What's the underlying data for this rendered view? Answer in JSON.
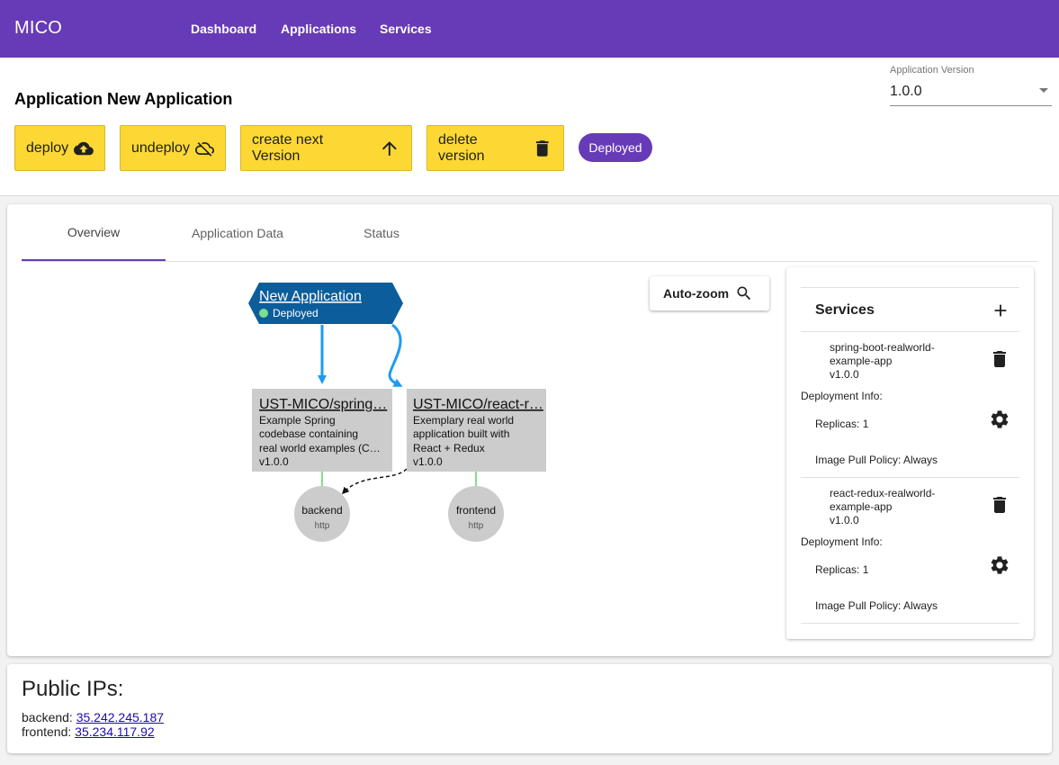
{
  "topbar": {
    "brand": "MICO",
    "nav": [
      "Dashboard",
      "Applications",
      "Services"
    ]
  },
  "app": {
    "title": "Application New Application",
    "version_label": "Application Version",
    "version_value": "1.0.0",
    "status": "Deployed"
  },
  "actions": {
    "deploy": "deploy",
    "undeploy": "undeploy",
    "create_next": "create next Version",
    "delete_version": "delete version"
  },
  "tabs": [
    "Overview",
    "Application Data",
    "Status"
  ],
  "graph": {
    "autozoom_label": "Auto-zoom",
    "app_node": {
      "title": "New Application",
      "status": "Deployed"
    },
    "service_nodes": [
      {
        "title": "UST-MICO/spring…",
        "desc": [
          "Example Spring",
          "codebase containing",
          "real world examples (C…"
        ],
        "version": "v1.0.0"
      },
      {
        "title": "UST-MICO/react-r…",
        "desc": [
          "Exemplary real world",
          "application built with",
          "React + Redux"
        ],
        "version": "v1.0.0"
      }
    ],
    "interfaces": [
      {
        "name": "backend",
        "protocol": "http"
      },
      {
        "name": "frontend",
        "protocol": "http"
      }
    ]
  },
  "services_panel": {
    "title": "Services",
    "deployment_info_label": "Deployment Info:",
    "items": [
      {
        "name_lines": [
          "spring-boot-realworld-",
          "example-app"
        ],
        "version": "v1.0.0",
        "replicas": "Replicas: 1",
        "pull_policy": "Image Pull Policy: Always"
      },
      {
        "name_lines": [
          "react-redux-realworld-",
          "example-app"
        ],
        "version": "v1.0.0",
        "replicas": "Replicas: 1",
        "pull_policy": "Image Pull Policy: Always"
      }
    ]
  },
  "public_ips": {
    "title": "Public IPs:",
    "rows": [
      {
        "label": "backend:",
        "ip": "35.242.245.187 "
      },
      {
        "label": "frontend:",
        "ip": "35.234.117.92 "
      }
    ]
  },
  "colors": {
    "primary": "#673ab7",
    "accent": "#fdd835",
    "app_node": "#0b5d9b",
    "edge": "#1e9bf0",
    "node_fill": "#cccccc",
    "status_dot": "#7ee08a",
    "link": "#1a0dab"
  }
}
